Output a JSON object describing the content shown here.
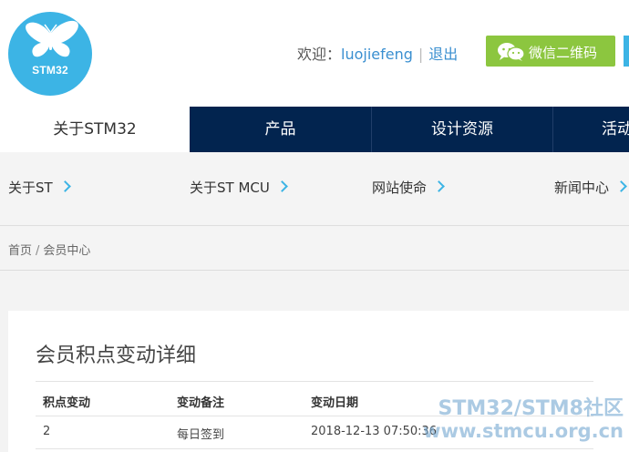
{
  "logo": {
    "text": "STM32"
  },
  "header": {
    "welcome": "欢迎：",
    "username": "luojiefeng",
    "separator": "|",
    "logout": "退出",
    "wechat_button": "微信二维码"
  },
  "nav": {
    "items": [
      {
        "label": "关于STM32",
        "active": true
      },
      {
        "label": "产品",
        "active": false
      },
      {
        "label": "设计资源",
        "active": false
      },
      {
        "label": "活动",
        "active": false
      }
    ]
  },
  "subnav": {
    "items": [
      {
        "label": "关于ST"
      },
      {
        "label": "关于ST MCU"
      },
      {
        "label": "网站使命"
      },
      {
        "label": "新闻中心"
      }
    ]
  },
  "breadcrumb": {
    "home": "首页",
    "separator": "/",
    "current": "会员中心"
  },
  "card": {
    "title": "会员积点变动详细",
    "columns": [
      "积点变动",
      "变动备注",
      "变动日期"
    ],
    "rows": [
      {
        "change": "2",
        "note": "每日签到",
        "date": "2018-12-13 07:50:36"
      }
    ]
  },
  "watermark": {
    "line1": "STM32/STM8社区",
    "line2": "www.stmcu.org.cn"
  },
  "colors": {
    "nav_bg": "#02244f",
    "accent": "#3cb4e5",
    "wechat_green": "#8cc63f",
    "link": "#3a8fd0"
  }
}
